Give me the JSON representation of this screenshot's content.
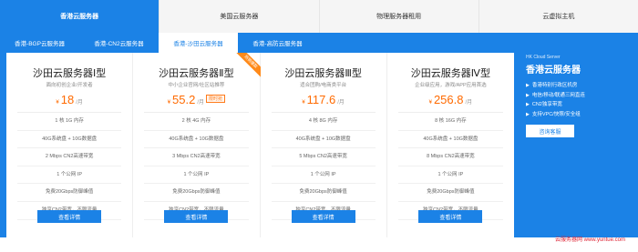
{
  "top_tabs": [
    {
      "label": "香港云服务器"
    },
    {
      "label": "美国云服务器"
    },
    {
      "label": "物理服务器租用"
    },
    {
      "label": "云虚拟主机"
    }
  ],
  "sub_tabs": [
    {
      "label": "香港-BGP云服务器"
    },
    {
      "label": "香港-CN2云服务器"
    },
    {
      "label": "香港-沙田云服务器"
    },
    {
      "label": "香港-高防云服务器"
    }
  ],
  "cards": [
    {
      "title": "沙田云服务器Ⅰ型",
      "subtitle": "面向初创企业/开发者",
      "currency": "¥",
      "price": "18",
      "unit": "/月",
      "badge": "",
      "specs": [
        "1 核 1G 内存",
        "40G系统盘 + 10G数据盘",
        "2 Mbps CN2高速带宽",
        "1 个公网 IP",
        "免费20Gbps防御峰值",
        "独享CN2带宽，不限流量"
      ],
      "button": "查看详情"
    },
    {
      "title": "沙田云服务器Ⅱ型",
      "subtitle": "中小企业官网/社区站推荐",
      "currency": "¥",
      "price": "55.2",
      "unit": "/月",
      "badge": "限时抢",
      "ribbon": "热销爆款",
      "specs": [
        "2 核 4G 内存",
        "40G系统盘 + 10G数据盘",
        "3 Mbps CN2高速带宽",
        "1 个公网 IP",
        "免费20Gbps防御峰值",
        "独享CN2带宽，不限流量"
      ],
      "button": "查看详情"
    },
    {
      "title": "沙田云服务器Ⅲ型",
      "subtitle": "适合团购/电商类平台",
      "currency": "¥",
      "price": "117.6",
      "unit": "/月",
      "badge": "",
      "specs": [
        "4 核 8G 内存",
        "40G系统盘 + 10G数据盘",
        "5 Mbps CN2高速带宽",
        "1 个公网 IP",
        "免费20Gbps防御峰值",
        "独享CN2带宽，不限流量"
      ],
      "button": "查看详情"
    },
    {
      "title": "沙田云服务器Ⅳ型",
      "subtitle": "企业级应用，游戏/APP应用首选",
      "currency": "¥",
      "price": "256.8",
      "unit": "/月",
      "badge": "",
      "specs": [
        "8 核 16G 内存",
        "40G系统盘 + 10G数据盘",
        "8 Mbps CN2高速带宽",
        "1 个公网 IP",
        "免费20Gbps防御峰值",
        "独享CN2带宽，不限流量"
      ],
      "button": "查看详情"
    }
  ],
  "side": {
    "subtitle": "HK Cloud Server",
    "title": "香港云服务器",
    "features": [
      "香港特别行政区机房",
      "电信/移动/联通三网直连",
      "CN2独享带宽",
      "支持VPC/快照/安全组"
    ],
    "button": "咨询客服"
  },
  "watermark": "云服务器网 www.yuntue.com",
  "colors": {
    "accent": "#1b82e6",
    "price": "#ff6a00",
    "ribbon": "#ff8a1a"
  }
}
